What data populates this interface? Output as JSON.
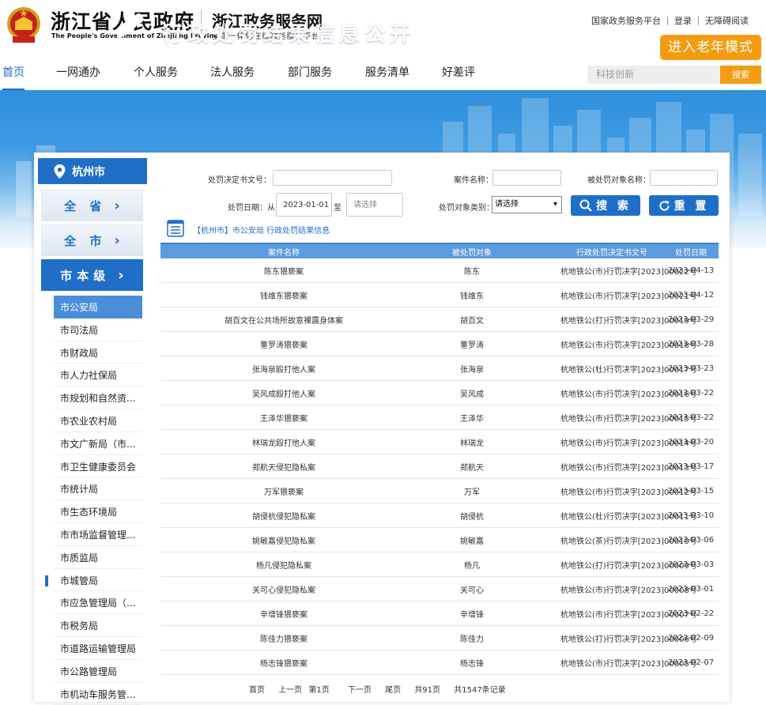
{
  "header": {
    "gov_name": "浙江省人民政府",
    "gov_name_en": "The People's Government of Zhejiang Province",
    "portal_name": "浙江政务服务网",
    "portal_sub": "全国一体化在线政务服务平台",
    "links": [
      "国家政务服务平台",
      "登录",
      "无障碍阅读"
    ],
    "elder_mode": "进入老年模式"
  },
  "nav": {
    "items": [
      "首页",
      "一网通办",
      "个人服务",
      "法人服务",
      "部门服务",
      "服务清单",
      "好差评"
    ],
    "search_placeholder": "科技创新",
    "search_button": "搜索"
  },
  "banner": {
    "title": "行政处罚结果信息公开"
  },
  "sidebar": {
    "city": "杭州市",
    "levels": [
      "全 省",
      "全 市",
      "市本级"
    ],
    "departments": [
      "市公安局",
      "市司法局",
      "市财政局",
      "市人力社保局",
      "市规划和自然资...",
      "市农业农村局",
      "市文广新局（市...",
      "市卫生健康委员会",
      "市统计局",
      "市生态环境局",
      "市市场监督管理...",
      "市质监局",
      "市城管局",
      "市应急管理局（...",
      "市税务局",
      "市道路运输管理局",
      "市公路管理局",
      "市机动车服务管..."
    ]
  },
  "form": {
    "doc_no_label": "处罚决定书文号：",
    "case_name_label": "案件名称：",
    "target_name_label": "被处罚对象名称：",
    "date_label": "处罚日期：从",
    "date_from": "2023-01-01",
    "date_to_label": "至",
    "date_to_placeholder": "请选择",
    "target_type_label": "处罚对象类别：",
    "target_type_value": "请选择",
    "search_button": "搜 索",
    "reset_button": "重 置"
  },
  "table": {
    "breadcrumb": "【杭州市】市公安局 行政处罚结果信息",
    "headers": [
      "案件名称",
      "被处罚对象",
      "行政处罚决定书文号",
      "处罚日期"
    ],
    "rows": [
      [
        "陈东猥亵案",
        "陈东",
        "杭地铁公(市)行罚决字[2023]00022号",
        "2023-04-13"
      ],
      [
        "钱维东猥亵案",
        "钱维东",
        "杭地铁公(市)行罚决字[2023]00021号",
        "2023-04-12"
      ],
      [
        "胡百文在公共场所故意裸露身体案",
        "胡百文",
        "杭地铁公(打)行罚决字[2023]00019号",
        "2023-03-29"
      ],
      [
        "董罗涛猥亵案",
        "董罗涛",
        "杭地铁公(市)行罚决字[2023]00018号",
        "2023-03-28"
      ],
      [
        "张海泉殴打他人案",
        "张海泉",
        "杭地铁公(杜)行罚决字[2023]00017号",
        "2023-03-23"
      ],
      [
        "吴风成殴打他人案",
        "吴风成",
        "杭地铁公(市)行罚决字[2023]00016号",
        "2023-03-22"
      ],
      [
        "王泽华猥亵案",
        "王泽华",
        "杭地铁公(市)行罚决字[2023]00015号",
        "2023-03-22"
      ],
      [
        "林瑞龙殴打他人案",
        "林瑞龙",
        "杭地铁公(市)行罚决字[2023]00014号",
        "2023-03-20"
      ],
      [
        "郑航天侵犯隐私案",
        "郑航天",
        "杭地铁公(市)行罚决字[2023]00013号",
        "2023-03-17"
      ],
      [
        "万军猥亵案",
        "万军",
        "杭地铁公(市)行罚决字[2023]00012号",
        "2023-03-15"
      ],
      [
        "胡侵杭侵犯隐私案",
        "胡侵杭",
        "杭地铁公(杜)行罚决字[2023]00011号",
        "2023-03-10"
      ],
      [
        "姚敏嘉侵犯隐私案",
        "姚敏嘉",
        "杭地铁公(茶)行罚决字[2023]00010号",
        "2023-03-06"
      ],
      [
        "杨凡侵犯隐私案",
        "杨凡",
        "杭地铁公(打)行罚决字[2023]00009号",
        "2023-03-03"
      ],
      [
        "关可心侵犯隐私案",
        "关可心",
        "杭地铁公(市)行罚决字[2023]00008号",
        "2023-03-01"
      ],
      [
        "辛增锋猥亵案",
        "辛增锋",
        "杭地铁公(市)行罚决字[2023]00007号",
        "2023-02-22"
      ],
      [
        "陈佳力猥亵案",
        "陈佳力",
        "杭地铁公(打)行罚决字[2023]00006号",
        "2023-02-09"
      ],
      [
        "杨志锋猥亵案",
        "杨志锋",
        "杭地铁公(市)行罚决字[2023]00005号",
        "2023-02-07"
      ]
    ]
  },
  "pager": {
    "first": "首页",
    "prev": "上一页",
    "current": "第1页",
    "next": "下一页",
    "last": "尾页",
    "total_pages": "共91页",
    "total_records": "共1547条记录"
  },
  "colors": {
    "primary": "#1f6fc9",
    "accent": "#f39c12",
    "table_head": "#5b9be0"
  }
}
